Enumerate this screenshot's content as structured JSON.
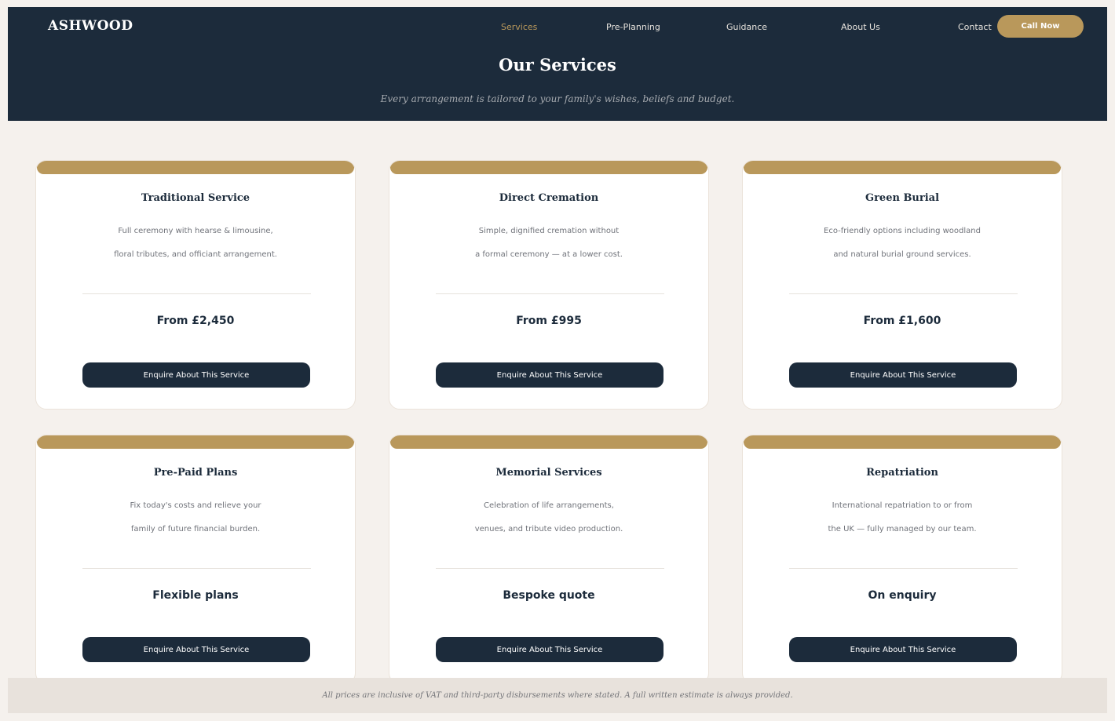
{
  "brand": {
    "logo": "ASHWOOD"
  },
  "nav": {
    "items": [
      {
        "label": "Services"
      },
      {
        "label": "Pre-Planning"
      },
      {
        "label": "Guidance"
      },
      {
        "label": "About Us"
      },
      {
        "label": "Contact"
      }
    ],
    "cta_label": "Call Now"
  },
  "hero": {
    "title": "Our Services",
    "subtitle": "Every arrangement is tailored to your family's wishes, beliefs and budget."
  },
  "cards": [
    {
      "title": "Traditional Service",
      "desc1": "Full ceremony with hearse & limousine,",
      "desc2": "floral tributes, and officiant arrangement.",
      "price": "From £2,450",
      "button": "Enquire About This Service"
    },
    {
      "title": "Direct Cremation",
      "desc1": "Simple, dignified cremation without",
      "desc2": "a formal ceremony — at a lower cost.",
      "price": "From £995",
      "button": "Enquire About This Service"
    },
    {
      "title": "Green Burial",
      "desc1": "Eco-friendly options including woodland",
      "desc2": "and natural burial ground services.",
      "price": "From £1,600",
      "button": "Enquire About This Service"
    },
    {
      "title": "Pre-Paid Plans",
      "desc1": "Fix today's costs and relieve your",
      "desc2": "family of future financial burden.",
      "price": "Flexible plans",
      "button": "Enquire About This Service"
    },
    {
      "title": "Memorial Services",
      "desc1": "Celebration of life arrangements,",
      "desc2": "venues, and tribute video production.",
      "price": "Bespoke quote",
      "button": "Enquire About This Service"
    },
    {
      "title": "Repatriation",
      "desc1": "International repatriation to or from",
      "desc2": "the UK — fully managed by our team.",
      "price": "On enquiry",
      "button": "Enquire About This Service"
    }
  ],
  "footer": {
    "note": "All prices are inclusive of VAT and third-party disbursements where stated. A full written estimate is always provided."
  },
  "colors": {
    "navy": "#1c2b3b",
    "gold": "#b9985b",
    "background": "#f5f1ed"
  }
}
